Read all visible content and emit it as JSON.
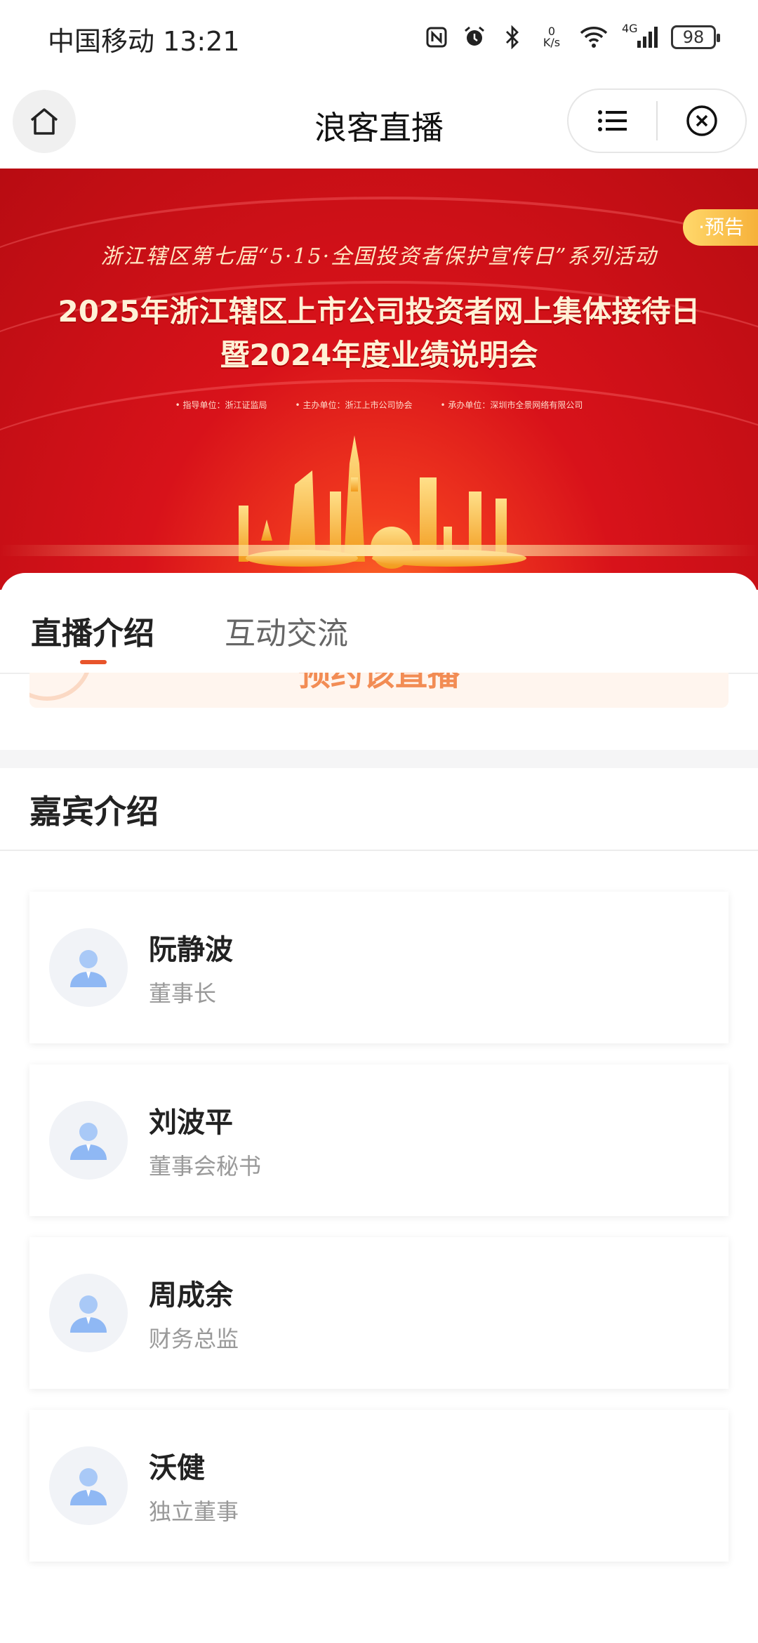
{
  "status_bar": {
    "carrier_time": "中国移动 13:21",
    "net_speed_value": "0",
    "net_speed_unit": "K/s",
    "network": "4G",
    "battery": "98"
  },
  "nav": {
    "title": "浪客直播"
  },
  "banner": {
    "tag": "·预告",
    "subtitle": "浙江辖区第七届“5·15·全国投资者保护宣传日”系列活动",
    "title_line1": "2025年浙江辖区上市公司投资者网上集体接待日",
    "title_line2": "暨2024年度业绩说明会",
    "orgs": [
      "• 指导单位：浙江证监局",
      "• 主办单位：浙江上市公司协会",
      "• 承办单位：深圳市全景网络有限公司"
    ]
  },
  "tabs": [
    {
      "label": "直播介绍",
      "active": true
    },
    {
      "label": "互动交流",
      "active": false
    }
  ],
  "reserve_peek_text": "预约该直播",
  "guests_section": {
    "title": "嘉宾介绍",
    "guests": [
      {
        "name": "阮静波",
        "role": "董事长"
      },
      {
        "name": "刘波平",
        "role": "董事会秘书"
      },
      {
        "name": "周成余",
        "role": "财务总监"
      },
      {
        "name": "沃健",
        "role": "独立董事"
      }
    ]
  },
  "colors": {
    "accent": "#e8542b",
    "banner_red": "#d8121a",
    "tag_gold": "#f6b13a"
  }
}
